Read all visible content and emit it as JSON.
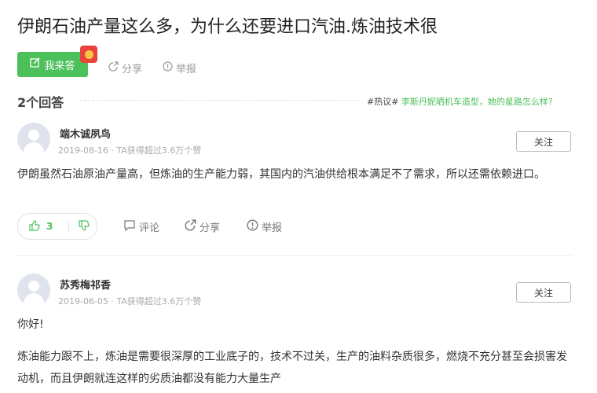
{
  "question": {
    "title": "伊朗石油产量这么多，为什么还要进口汽油.炼油技术很",
    "answer_button": "我来答",
    "share": "分享",
    "report": "举报"
  },
  "answers_header": {
    "count_label": "2个回答",
    "hot_tag": "#热议#",
    "hot_link": "李斯丹妮晒机车造型，她的星路怎么样?"
  },
  "answers": [
    {
      "user": "端木诚夙鸟",
      "meta": "2019-08-16 · TA获得超过3.6万个赞",
      "follow": "关注",
      "paragraphs": [
        "伊朗虽然石油原油产量高，但炼油的生产能力弱，其国内的汽油供给根本满足不了需求，所以还需依赖进口。"
      ],
      "likes": "3",
      "comment": "评论",
      "share": "分享",
      "report": "举报"
    },
    {
      "user": "苏秀梅祁香",
      "meta": "2019-06-05 · TA获得超过3.6万个赞",
      "follow": "关注",
      "paragraphs": [
        "你好!",
        "炼油能力跟不上，炼油是需要很深厚的工业底子的，技术不过关，生产的油料杂质很多，燃烧不充分甚至会损害发动机，而且伊朗就连这样的劣质油都没有能力大量生产"
      ]
    }
  ]
}
